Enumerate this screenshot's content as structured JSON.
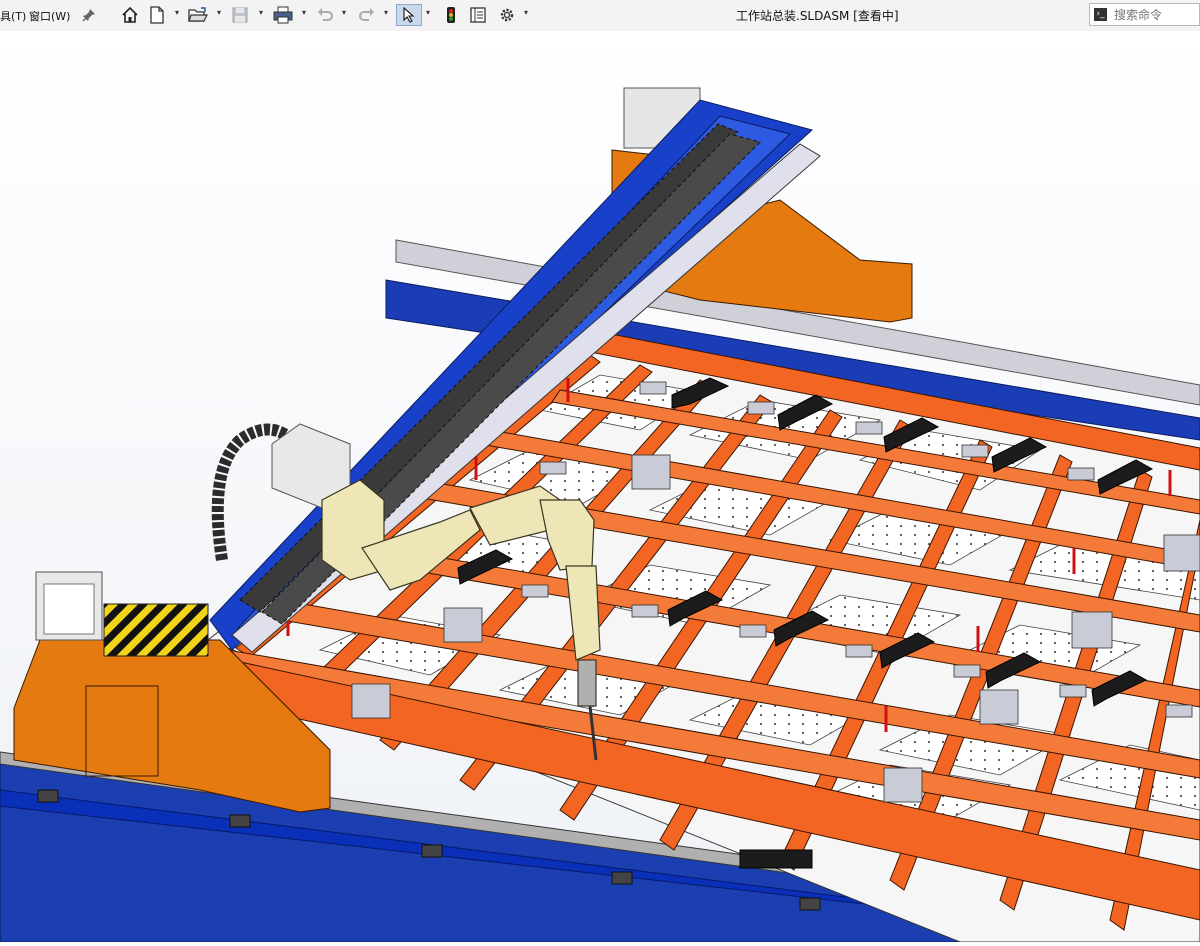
{
  "menus": [
    {
      "label": "具(T)"
    },
    {
      "label": "窗口(W)"
    }
  ],
  "window": {
    "title": "工作站总装.SLDASM [查看中]"
  },
  "search": {
    "placeholder": "搜索命令"
  },
  "colors": {
    "orange": "#f26522",
    "blue": "#0a2fb8",
    "gray": "#d8d8d8",
    "robot": "#efe6b8"
  },
  "icons": [
    "home-icon",
    "new-file-icon",
    "open-folder-icon",
    "save-icon",
    "print-icon",
    "undo-icon",
    "redo-icon",
    "select-pointer-icon",
    "traffic-light-icon",
    "file-properties-icon",
    "options-gear-icon",
    "zoom-to-fit-icon",
    "zoom-area-icon",
    "previous-view-icon",
    "section-view-icon",
    "view-orientation-icon",
    "display-style-icon",
    "hide-show-icon",
    "edit-appearance-icon",
    "apply-scene-icon",
    "view-settings-icon"
  ]
}
